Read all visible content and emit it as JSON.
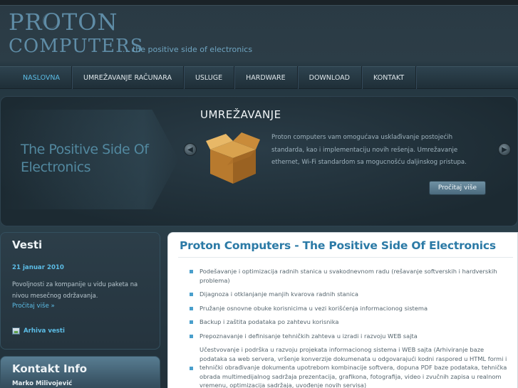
{
  "logo": {
    "line1": "PROTON",
    "line2": "COMPUTERS",
    "tagline": "... the positive side of electronics"
  },
  "nav": {
    "items": [
      {
        "label": "NASLOVNA",
        "active": true
      },
      {
        "label": "UMREŽAVANJE RAČUNARA",
        "active": false
      },
      {
        "label": "USLUGE",
        "active": false
      },
      {
        "label": "HARDWARE",
        "active": false
      },
      {
        "label": "DOWNLOAD",
        "active": false
      },
      {
        "label": "KONTAKT",
        "active": false
      }
    ]
  },
  "slider": {
    "background_text_line1": "The Positive Side Of",
    "background_text_line2": "Electronics",
    "title": "UMREŽAVANJE",
    "text": "Proton computers vam omogućava usklađivanje postojećih standarda, kao i implementaciju novih rešenja. Umrežavanje ethernet, Wi-Fi standardom sa mogucnošću daljinskog pristupa.",
    "more_label": "Pročitaj više",
    "prev_icon": "chevron-left-icon",
    "next_icon": "chevron-right-icon"
  },
  "vesti": {
    "title": "Vesti",
    "date": "21 januar 2010",
    "text": "Povoljnosti za kompanije u vidu paketa na nivou mesečnog održavanja.",
    "more_label": "Pročitaj više »",
    "archive_label": "Arhiva vesti"
  },
  "kontakt": {
    "title": "Kontakt Info",
    "name": "Marko Milivojević"
  },
  "main": {
    "title": "Proton Computers - The Positive Side Of Electronics",
    "services": [
      "Podešavanje i optimizacija radnih stanica u svakodnevnom radu (rešavanje softverskih i hardverskih problema)",
      "Dijagnoza i otklanjanje manjih kvarova radnih stanica",
      "Pružanje osnovne obuke korisnicima u vezi korišćenja informacionog sistema",
      "Backup i zaštita podataka po zahtevu korisnika",
      "Prepoznavanje i definisanje tehničkih zahteva u izradi i razvoju WEB sajta",
      "Učestvovanje i podrška u razvoju projekata informacionog sistema i WEB sajta (Arhiviranje baze podataka sa web servera, vršenje konverzije dokumenata u odgovarajući kodni raspored u HTML formi i tehnički obrađivanje dokumenta upotrebom kombinacije softvera, dopuna PDF baze podataka, tehnička obrada multimedijalnog sadržaja prezentacija, grafikona, fotografija, video i zvučnih zapisa u realnom vremenu, optimizacija sadržaja, uvođenje novih servisa)"
    ]
  },
  "colors": {
    "accent": "#5cbde6",
    "title_blue": "#2b7aa6",
    "background": "#23333d"
  }
}
